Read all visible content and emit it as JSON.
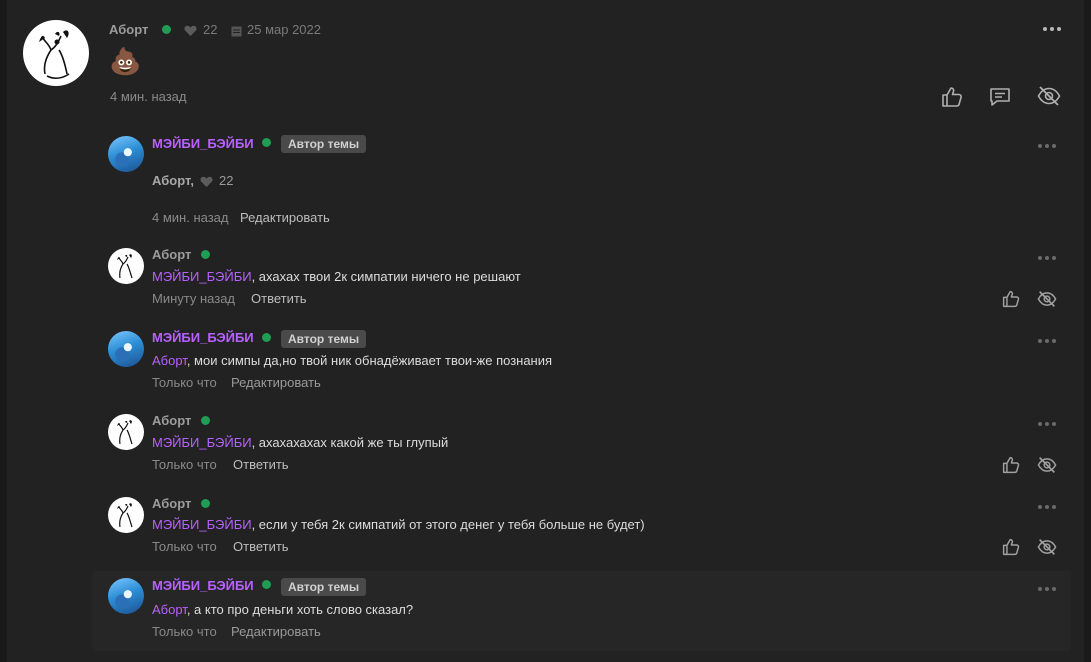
{
  "main_post": {
    "author": "Аборт",
    "likes": "22",
    "date": "25 мар 2022",
    "content": "💩",
    "time": "4 мин. назад"
  },
  "replies": [
    {
      "author": "МЭЙБИ_БЭЙБИ",
      "badge": "Автор темы",
      "quote_author": "Аборт,",
      "quote_likes": "22",
      "time": "4 мин. назад",
      "action": "Редактировать"
    },
    {
      "author": "Аборт",
      "mention": "МЭЙБИ_БЭЙБИ",
      "text": ", ахахах твои 2к симпатии ничего не решают",
      "time": "Минуту назад",
      "action": "Ответить"
    },
    {
      "author": "МЭЙБИ_БЭЙБИ",
      "badge": "Автор темы",
      "mention": "Аборт",
      "text": ", мои симпы да,но твой ник обнадёживает твои-же познания",
      "time": "Только что",
      "action": "Редактировать"
    },
    {
      "author": "Аборт",
      "mention": "МЭЙБИ_БЭЙБИ",
      "text": ", ахахахахах какой же ты глупый",
      "time": "Только что",
      "action": "Ответить"
    },
    {
      "author": "Аборт",
      "mention": "МЭЙБИ_БЭЙБИ",
      "text": ", если у тебя 2к симпатий от этого денег у тебя больше не будет)",
      "time": "Только что",
      "action": "Ответить"
    },
    {
      "author": "МЭЙБИ_БЭЙБИ",
      "badge": "Автор темы",
      "mention": "Аборт",
      "text": ", а кто про деньги хоть слово сказал?",
      "time": "Только что",
      "action": "Редактировать"
    }
  ],
  "colors": {
    "background": "#222222",
    "mention": "#b761ff",
    "online": "#1f9d55",
    "badge": "#4a4a4a"
  },
  "icons": [
    "more-icon",
    "heart-icon",
    "calendar-icon",
    "like-icon",
    "comment-icon",
    "hide-icon"
  ]
}
